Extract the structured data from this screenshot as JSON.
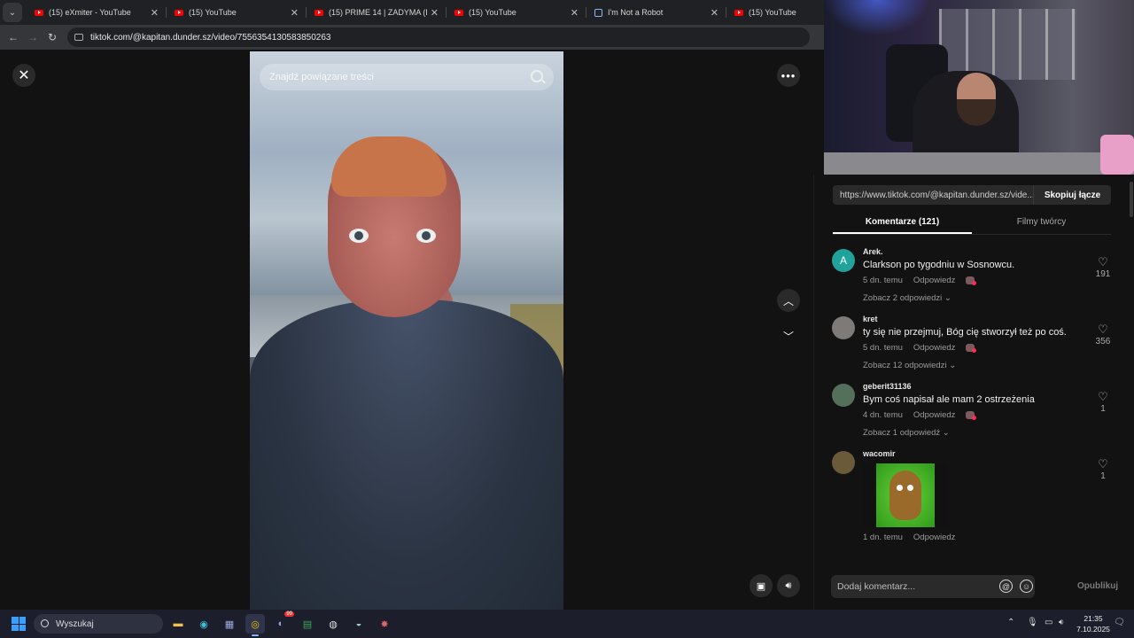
{
  "browser": {
    "tabs": [
      {
        "title": "(15) eXmiter - YouTube",
        "icon": "youtube-icon"
      },
      {
        "title": "(15) YouTube",
        "icon": "youtube-icon"
      },
      {
        "title": "(15) PRIME 14 | ZADYMA (DŻAB",
        "icon": "youtube-icon"
      },
      {
        "title": "(15) YouTube",
        "icon": "youtube-icon"
      },
      {
        "title": "I'm Not a Robot",
        "icon": "robot-icon"
      },
      {
        "title": "(15) YouTube",
        "icon": "youtube-icon"
      }
    ],
    "url": "tiktok.com/@kapitan.dunder.sz/video/7556354130583850263"
  },
  "viewer": {
    "search_placeholder": "Znajdź powiązane treści"
  },
  "panel": {
    "share_url": "https://www.tiktok.com/@kapitan.dunder.sz/vide...",
    "copy_label": "Skopiuj łącze",
    "tab_comments": "Komentarze (121)",
    "tab_creator_videos": "Filmy twórcy",
    "comments": [
      {
        "user": "Arek.",
        "avatar_letter": "A",
        "avatar_color": "#1fa39a",
        "text": "Clarkson po tygodniu w Sosnowcu.",
        "time": "5 dn. temu",
        "reply": "Odpowiedz",
        "replies": "Zobacz 2 odpowiedzi",
        "likes": "191"
      },
      {
        "user": "kret",
        "avatar_letter": "",
        "avatar_color": "#7d7a78",
        "text": "ty się nie przejmuj, Bóg cię stworzył też po coś.",
        "time": "5 dn. temu",
        "reply": "Odpowiedz",
        "replies": "Zobacz 12 odpowiedzi",
        "likes": "356"
      },
      {
        "user": "geberit31136",
        "avatar_letter": "",
        "avatar_color": "#55705a",
        "text": "Bym coś napisał ale mam 2 ostrzeżenia",
        "time": "4 dn. temu",
        "reply": "Odpowiedz",
        "replies": "Zobacz 1 odpowiedź",
        "likes": "1"
      },
      {
        "user": "wacomir",
        "avatar_letter": "",
        "avatar_color": "#6a5a3a",
        "text": "",
        "time": "1 dn. temu",
        "reply": "Odpowiedz",
        "replies": "",
        "likes": "1"
      }
    ],
    "add_comment_placeholder": "Dodaj komentarz...",
    "publish_label": "Opublikuj"
  },
  "taskbar": {
    "search_label": "Wyszukaj",
    "discord_badge": "99",
    "time": "21:35",
    "date": "7.10.2025"
  }
}
